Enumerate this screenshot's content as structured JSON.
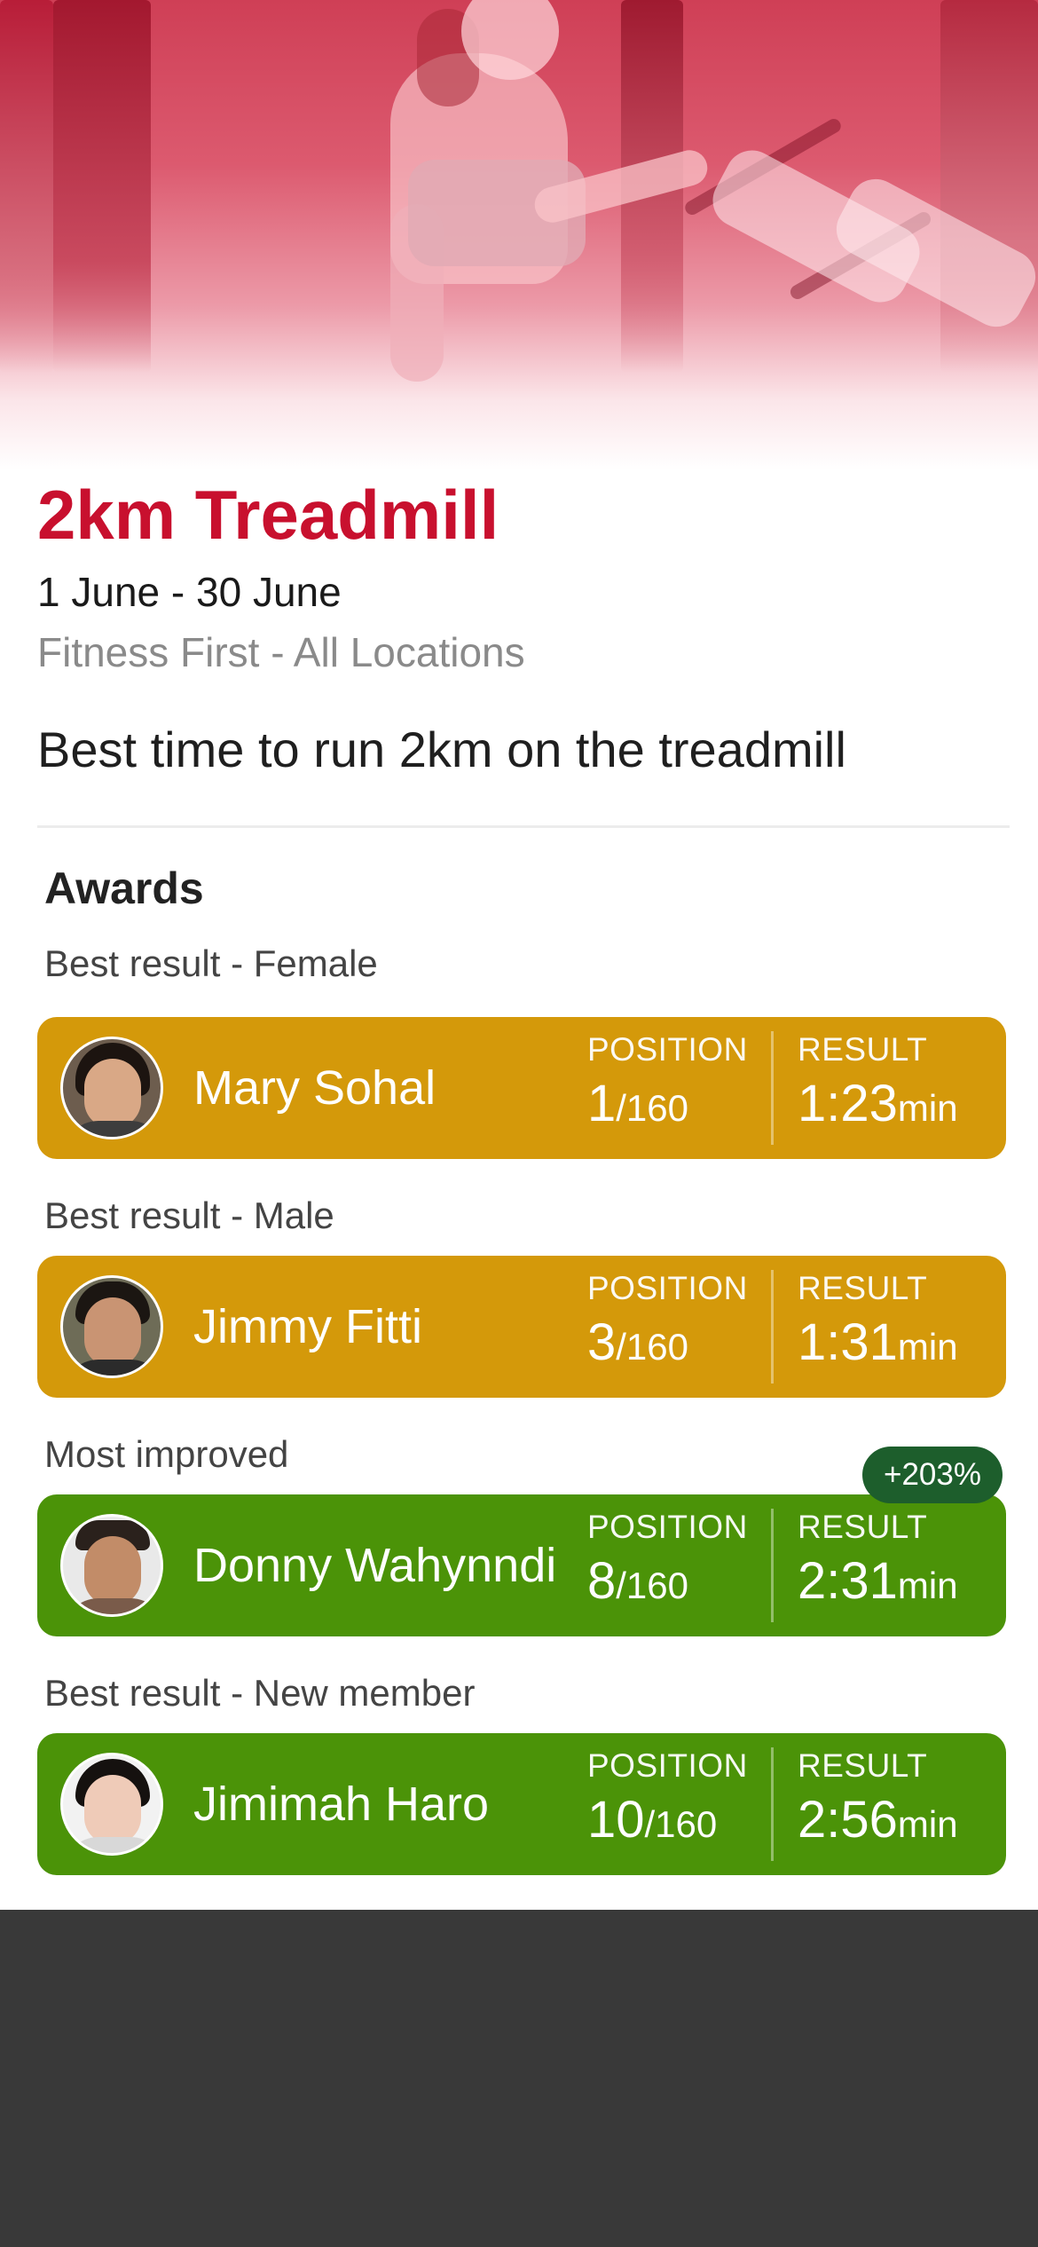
{
  "challenge": {
    "title": "2km Treadmill",
    "dates": "1 June - 30 June",
    "location": "Fitness First - All Locations",
    "description": "Best time to run 2km on the treadmill"
  },
  "awards": {
    "heading": "Awards",
    "position_label": "POSITION",
    "result_label": "RESULT",
    "total": "/160",
    "unit": "min",
    "items": [
      {
        "category": "Best result - Female",
        "name": "Mary Sohal",
        "position": "1",
        "result": "1:23",
        "color": "#d4990a"
      },
      {
        "category": "Best result - Male",
        "name": "Jimmy Fitti",
        "position": "3",
        "result": "1:31",
        "color": "#d4990a"
      },
      {
        "category": "Most improved",
        "name": "Donny Wahynndi",
        "position": "8",
        "result": "2:31",
        "color": "#4b9308",
        "improvement": "+203%"
      },
      {
        "category": "Best result - New member",
        "name": "Jimimah Haro",
        "position": "10",
        "result": "2:56",
        "color": "#4b9308"
      }
    ]
  },
  "colors": {
    "accent": "#c8102e",
    "gold": "#d4990a",
    "green": "#4b9308",
    "badge": "#1d5e2c"
  }
}
